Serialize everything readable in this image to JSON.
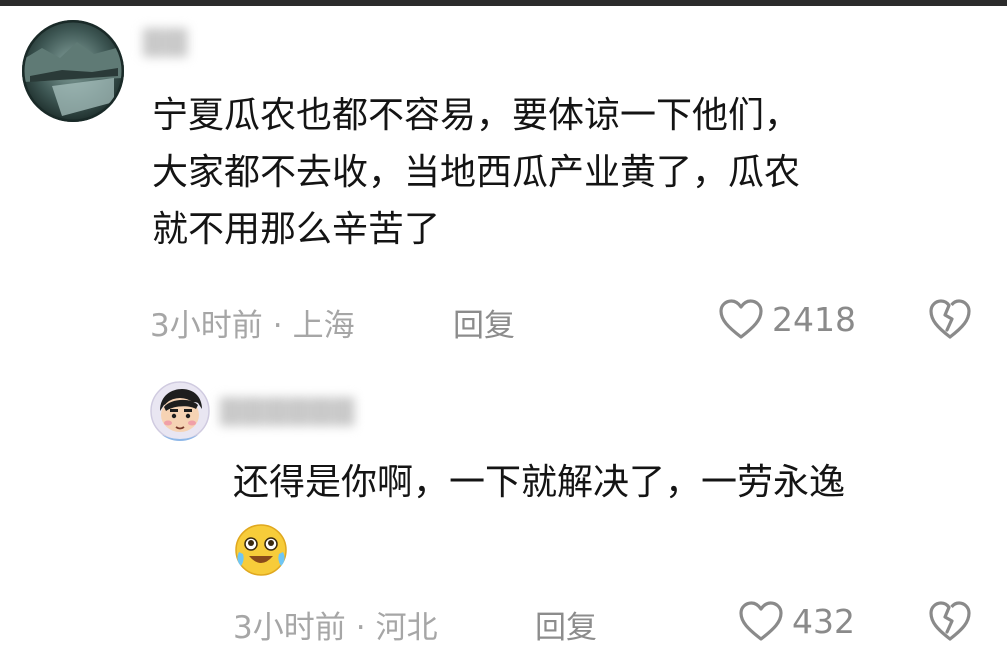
{
  "colors": {
    "text": "#141414",
    "meta": "#a6a6a6",
    "icon": "#8a8a8a",
    "topbar": "#2b2b2b"
  },
  "comments": [
    {
      "username": "▇▇",
      "avatar": "landscape-avatar",
      "lines": [
        "宁夏瓜农也都不容易，要体谅一下他们，",
        "大家都不去收，当地西瓜产业黄了，瓜农",
        "就不用那么辛苦了"
      ],
      "time": "3小时前",
      "separator": "·",
      "location": "上海",
      "reply_label": "回复",
      "like_count": "2418"
    },
    {
      "username": "▇▇▇▇▇▇",
      "avatar": "cartoon-boy-avatar",
      "lines": [
        "还得是你啊，一下就解决了，一劳永逸"
      ],
      "emoji": "laugh-cry-emoji",
      "time": "3小时前",
      "separator": "·",
      "location": "河北",
      "reply_label": "回复",
      "like_count": "432"
    }
  ]
}
